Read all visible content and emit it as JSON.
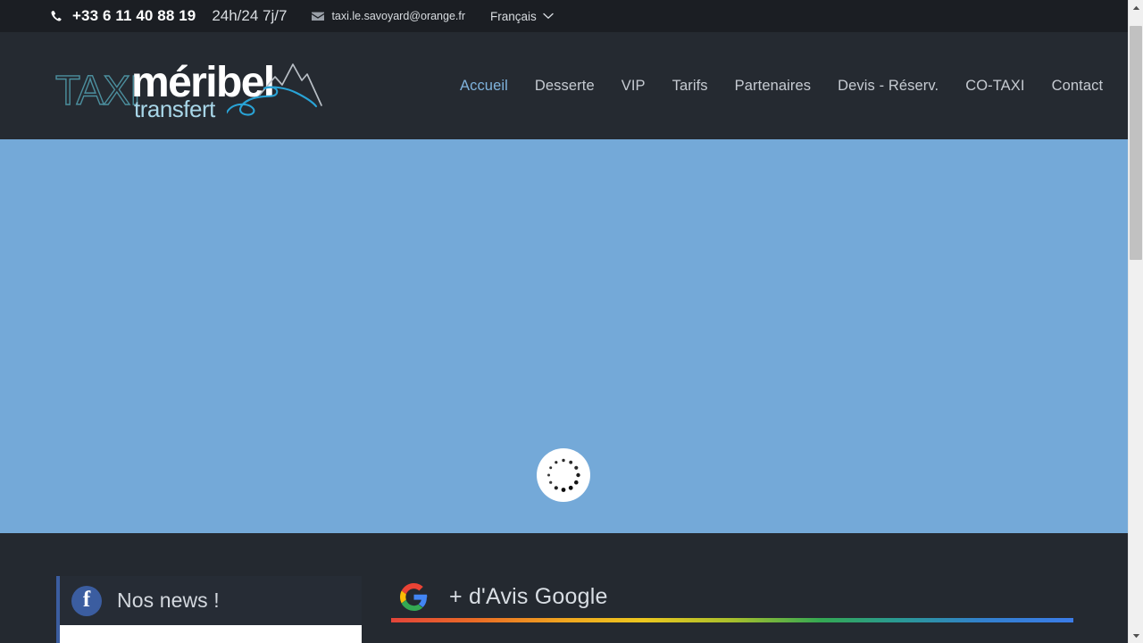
{
  "topbar": {
    "phone_icon": "phone-icon",
    "phone": "+33 6 11 40 88 19",
    "hours": "24h/24 7j/7",
    "mail_icon": "envelope-icon",
    "email": "taxi.le.savoyard@orange.fr",
    "language": "Français",
    "language_chevron": "chevron-down-icon"
  },
  "header": {
    "logo": {
      "taxi": "TAXI",
      "meribel": "méribel",
      "transfert": "transfert",
      "graphic": "mountain-road-icon"
    },
    "nav": [
      {
        "label": "Accueil",
        "active": true
      },
      {
        "label": "Desserte",
        "active": false
      },
      {
        "label": "VIP",
        "active": false
      },
      {
        "label": "Tarifs",
        "active": false
      },
      {
        "label": "Partenaires",
        "active": false
      },
      {
        "label": "Devis - Réserv.",
        "active": false
      },
      {
        "label": "CO-TAXI",
        "active": false
      },
      {
        "label": "Contact",
        "active": false
      }
    ]
  },
  "hero": {
    "background_color": "#74a9d8",
    "loader_icon": "spinner-icon",
    "loader_state": "loading"
  },
  "footer": {
    "background_color": "#242930",
    "facebook": {
      "icon": "facebook-icon",
      "title": "Nos news !",
      "accent_color": "#3b5da0"
    },
    "google": {
      "icon": "google-g-icon",
      "label": "+ d'Avis Google",
      "gradient_colors": [
        "#e3453a",
        "#ea6a26",
        "#f0a81f",
        "#ecc71f",
        "#a8bf2c",
        "#34a853",
        "#2a9a92",
        "#3380cf",
        "#3b7ce8"
      ]
    }
  },
  "browser": {
    "scrollbar": {
      "up_arrow": "caret-up-icon",
      "down_arrow": "caret-down-icon",
      "thumb": "scrollbar-thumb"
    }
  }
}
